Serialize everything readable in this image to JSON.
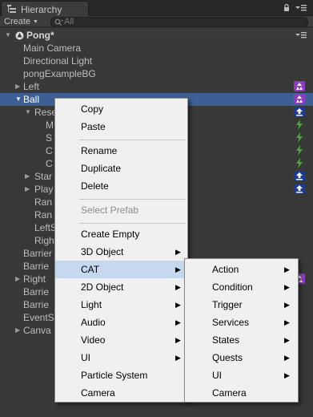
{
  "window": {
    "tab_title": "Hierarchy",
    "tab_icon": "hierarchy-icon",
    "lock_icon": "lock-icon",
    "menu_icon": "tab-menu-icon"
  },
  "toolbar": {
    "create_label": "Create",
    "search_placeholder": "All"
  },
  "hierarchy": {
    "scene_label": "Pong*",
    "items": {
      "main_camera": "Main Camera",
      "directional_light": "Directional Light",
      "pong_bg": "pongExampleBG",
      "left": "Left",
      "ball": "Ball",
      "ball_child_1": "Rese",
      "ball_child_1a": "M",
      "ball_child_1b": "S",
      "ball_child_1c": "C",
      "ball_child_1d": "C",
      "ball_child_2": "Star",
      "ball_child_3": "Play",
      "ball_child_4": "Ran",
      "ball_child_5": "Ran",
      "ball_child_6": "LeftS",
      "ball_child_7": "Righ",
      "barrier_1": "Barrier",
      "barrier_2": "Barrie",
      "right": "Right",
      "barrier_3": "Barrie",
      "barrier_4": "Barrie",
      "event_system": "EventS",
      "canvas": "Canva"
    }
  },
  "context_menu": {
    "copy": "Copy",
    "paste": "Paste",
    "rename": "Rename",
    "duplicate": "Duplicate",
    "delete": "Delete",
    "select_prefab": "Select Prefab",
    "create_empty": "Create Empty",
    "object_3d": "3D Object",
    "cat": "CAT",
    "object_2d": "2D Object",
    "light": "Light",
    "audio": "Audio",
    "video": "Video",
    "ui": "UI",
    "particle_system": "Particle System",
    "camera": "Camera"
  },
  "cat_submenu": {
    "action": "Action",
    "condition": "Condition",
    "trigger": "Trigger",
    "services": "Services",
    "states": "States",
    "quests": "Quests",
    "ui": "UI",
    "camera": "Camera"
  },
  "colors": {
    "panel_bg": "#383838",
    "selection": "#3e5f96",
    "menu_bg": "#f0f0f0",
    "menu_hover": "#c5d8f0"
  }
}
